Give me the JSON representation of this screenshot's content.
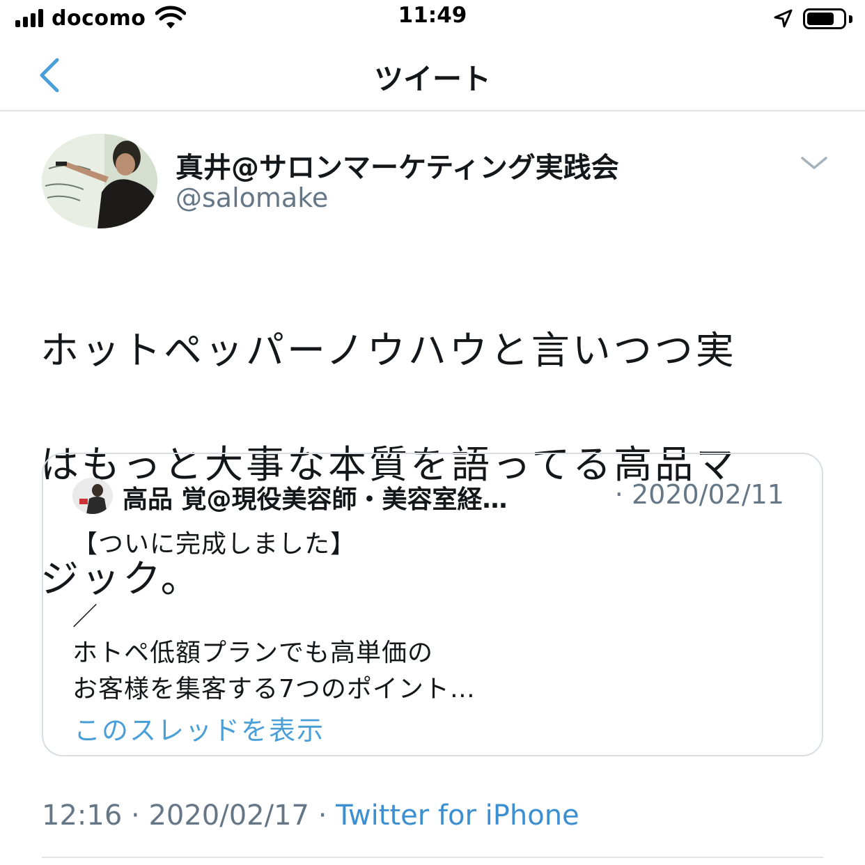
{
  "status_bar": {
    "carrier": "docomo",
    "time": "11:49",
    "battery_level": 0.75
  },
  "nav": {
    "title": "ツイート",
    "back_icon": "chevron-left-icon"
  },
  "tweet": {
    "display_name": "真井@サロンマーケティング実践会",
    "handle": "@salomake",
    "lines": [
      "ホットペッパーノウハウと言いつつ実",
      "はもっと大事な本質を語ってる高品マ",
      "ジック。"
    ],
    "time": "12:16",
    "separator": "·",
    "date": "2020/02/17",
    "source": "Twitter for iPhone"
  },
  "quoted_tweet": {
    "display_name": "高品 覚@現役美容師・美容室経…",
    "separator": "·",
    "date": "2020/02/11",
    "lines": [
      "【ついに完成しました】",
      "",
      "／",
      "ホトペ低額プランでも高単価の",
      "お客様を集客する7つのポイント…"
    ],
    "show_thread": "このスレッドを表示"
  },
  "colors": {
    "link_blue": "#3c8fd0",
    "secondary_gray": "#657786",
    "border_gray": "#d7dde2"
  }
}
